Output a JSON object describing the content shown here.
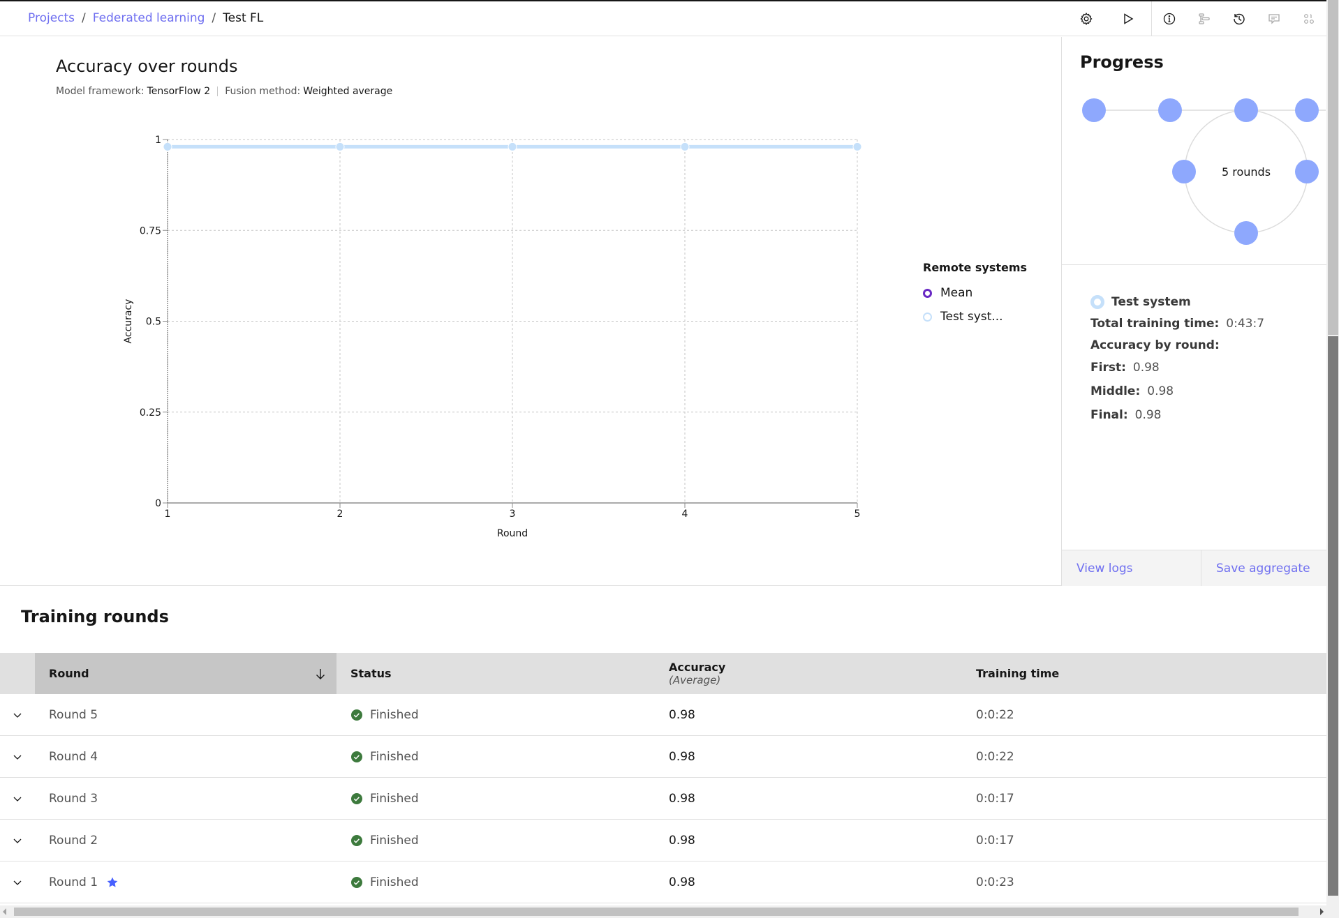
{
  "breadcrumb": {
    "items": [
      "Projects",
      "Federated learning"
    ],
    "current": "Test FL",
    "separator": "/"
  },
  "toolbar": {
    "icons": [
      "gear-icon",
      "play-icon",
      "info-icon",
      "tree-icon",
      "history-icon",
      "comment-icon",
      "binary-icon"
    ]
  },
  "chart_section": {
    "title": "Accuracy over rounds",
    "framework_label": "Model framework:",
    "framework_value": "TensorFlow 2",
    "fusion_label": "Fusion method:",
    "fusion_value": "Weighted average"
  },
  "chart_data": {
    "type": "line",
    "title": "Accuracy over rounds",
    "xlabel": "Round",
    "ylabel": "Accuracy",
    "x": [
      1,
      2,
      3,
      4,
      5
    ],
    "xticks": [
      "1",
      "2",
      "3",
      "4",
      "5"
    ],
    "yticks": [
      "0",
      "0.25",
      "0.5",
      "0.75",
      "1"
    ],
    "ytick_values": [
      0,
      0.25,
      0.5,
      0.75,
      1
    ],
    "xlim": [
      1,
      5
    ],
    "ylim": [
      0,
      1
    ],
    "grid": true,
    "legend_title": "Remote systems",
    "legend_position": "right",
    "series": [
      {
        "name": "Mean",
        "values": [
          0.98,
          0.98,
          0.98,
          0.98,
          0.98
        ],
        "color": "#6929c4",
        "visible": false
      },
      {
        "name": "Test syst...",
        "values": [
          0.98,
          0.98,
          0.98,
          0.98,
          0.98
        ],
        "color": "#c5e0fa",
        "visible": true
      }
    ]
  },
  "progress": {
    "title": "Progress",
    "rounds_label": "5 rounds",
    "node_color": "#8ea8fd"
  },
  "system_info": {
    "name": "Test system",
    "total_time_label": "Total training time:",
    "total_time_value": "0:43:7",
    "acc_by_round_label": "Accuracy by round:",
    "first_label": "First:",
    "first_value": "0.98",
    "middle_label": "Middle:",
    "middle_value": "0.98",
    "final_label": "Final:",
    "final_value": "0.98"
  },
  "actions": {
    "view_logs": "View logs",
    "save_aggregate": "Save aggregate"
  },
  "table": {
    "title": "Training rounds",
    "headers": {
      "round": "Round",
      "status": "Status",
      "accuracy": "Accuracy",
      "accuracy_sub": "(Average)",
      "training_time": "Training time"
    },
    "rows": [
      {
        "round": "Round 5",
        "status": "Finished",
        "accuracy": "0.98",
        "time": "0:0:22",
        "starred": false
      },
      {
        "round": "Round 4",
        "status": "Finished",
        "accuracy": "0.98",
        "time": "0:0:22",
        "starred": false
      },
      {
        "round": "Round 3",
        "status": "Finished",
        "accuracy": "0.98",
        "time": "0:0:17",
        "starred": false
      },
      {
        "round": "Round 2",
        "status": "Finished",
        "accuracy": "0.98",
        "time": "0:0:17",
        "starred": false
      },
      {
        "round": "Round 1",
        "status": "Finished",
        "accuracy": "0.98",
        "time": "0:0:23",
        "starred": true
      }
    ]
  },
  "colors": {
    "link": "#6f6ff0",
    "success": "#3d7a3d",
    "star": "#4760ff"
  }
}
